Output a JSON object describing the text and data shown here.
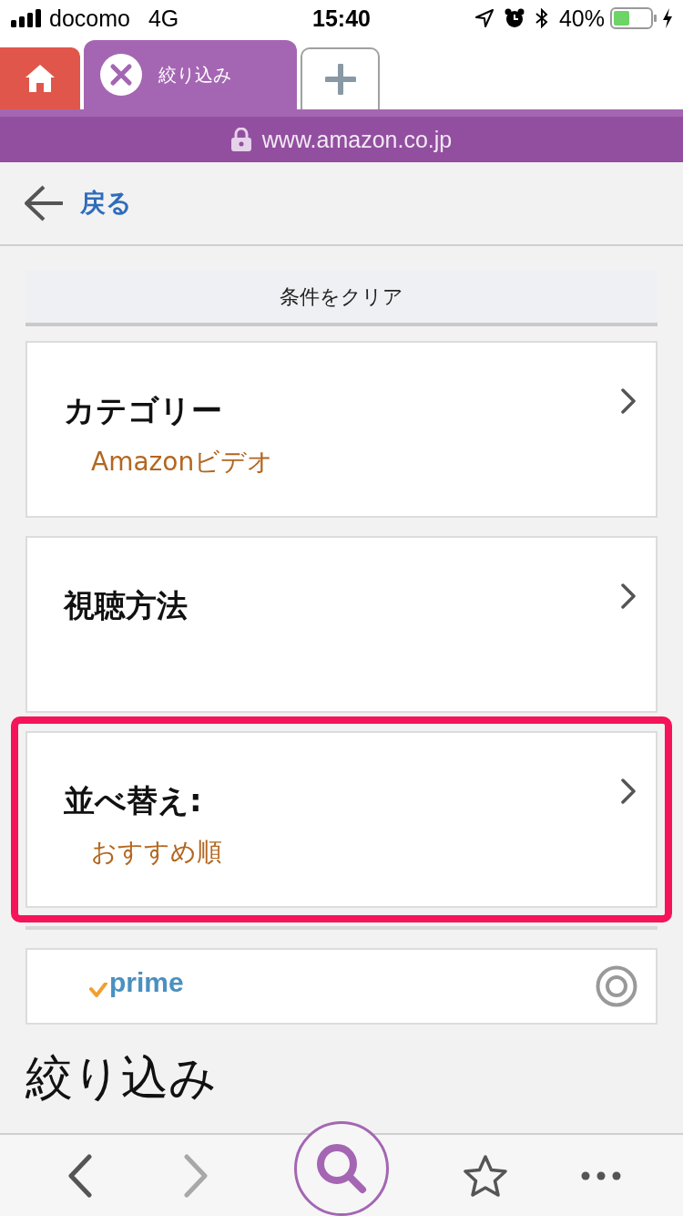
{
  "status_bar": {
    "carrier": "docomo",
    "network": "4G",
    "time": "15:40",
    "battery": "40%"
  },
  "tabs": [
    {
      "kind": "home",
      "selected": false
    },
    {
      "kind": "page",
      "label": "絞り込み",
      "selected": true
    },
    {
      "kind": "new",
      "selected": false
    }
  ],
  "address_bar": {
    "url": "www.amazon.co.jp"
  },
  "back_link": {
    "label": "戻る"
  },
  "clear_button": {
    "label": "条件をクリア"
  },
  "filters": [
    {
      "kind": "nav",
      "title": "カテゴリー",
      "value": "Amazonビデオ",
      "highlighted": false
    },
    {
      "kind": "nav",
      "title": "視聴方法",
      "highlighted": false
    },
    {
      "kind": "nav",
      "title": "並べ替え:",
      "value": "おすすめ順",
      "highlighted": true
    },
    {
      "kind": "toggle",
      "logo": "prime",
      "checked": true,
      "highlighted": false
    }
  ],
  "heading": "絞り込み",
  "toolbar": [
    {
      "kind": "back",
      "disabled": false
    },
    {
      "kind": "forward",
      "disabled": true
    },
    {
      "kind": "search",
      "disabled": false
    },
    {
      "kind": "bookmark",
      "disabled": false
    },
    {
      "kind": "more",
      "disabled": false
    }
  ]
}
